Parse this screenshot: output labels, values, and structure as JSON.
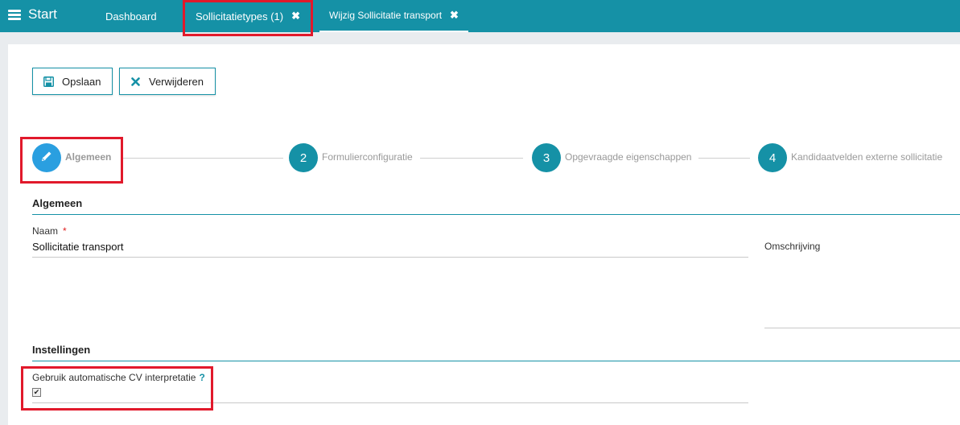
{
  "topbar": {
    "menu_label": "Start",
    "tabs": [
      {
        "label": "Dashboard"
      },
      {
        "label": "Sollicitatietypes (1)",
        "close": "✖"
      },
      {
        "label": "Wijzig Sollicitatie transport",
        "close": "✖"
      }
    ]
  },
  "toolbar": {
    "save_label": "Opslaan",
    "delete_label": "Verwijderen"
  },
  "stepper": {
    "steps": [
      {
        "number": "",
        "icon": "pencil-icon",
        "label": "Algemeen"
      },
      {
        "number": "2",
        "label": "Formulierconfiguratie"
      },
      {
        "number": "3",
        "label": "Opgevraagde eigenschappen"
      },
      {
        "number": "4",
        "label": "Kandidaatvelden externe sollicitatie"
      }
    ]
  },
  "general": {
    "title": "Algemeen",
    "name_label": "Naam",
    "required_mark": "*",
    "name_value": "Sollicitatie transport",
    "description_label": "Omschrijving"
  },
  "settings": {
    "title": "Instellingen",
    "cv_label": "Gebruik automatische CV interpretatie",
    "help_mark": "?",
    "cv_checked": true
  },
  "colors": {
    "brand": "#1591a6",
    "active_step": "#2a9fe0",
    "highlight": "#e1192b"
  }
}
